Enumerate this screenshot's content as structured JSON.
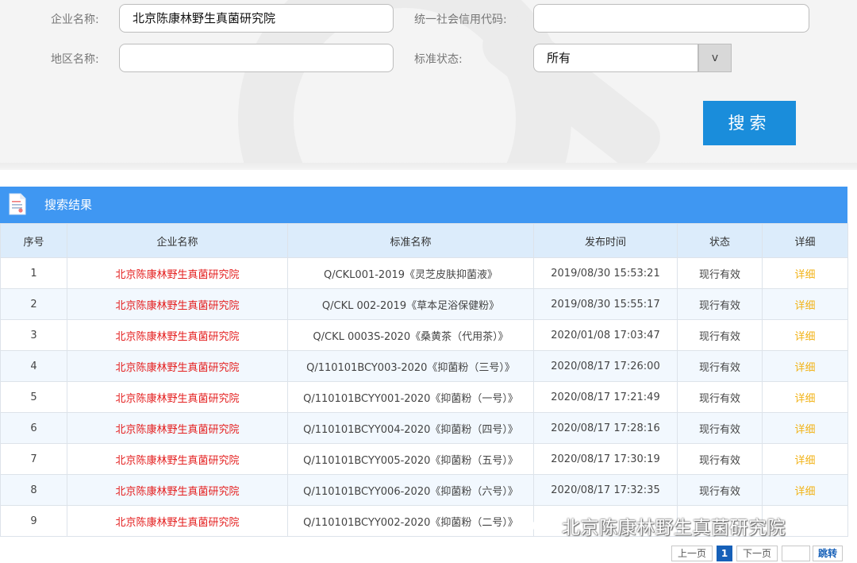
{
  "search": {
    "company_label": "企业名称:",
    "company_value": "北京陈康林野生真菌研究院",
    "credit_code_label": "统一社会信用代码:",
    "credit_code_value": "",
    "region_label": "地区名称:",
    "region_value": "",
    "status_label": "标准状态:",
    "status_value": "所有",
    "dropdown_glyph": "v",
    "search_button": "搜索"
  },
  "results": {
    "title": "搜索结果",
    "columns": [
      "序号",
      "企业名称",
      "标准名称",
      "发布时间",
      "状态",
      "详细"
    ],
    "rows": [
      {
        "no": "1",
        "company": "北京陈康林野生真菌研究院",
        "standard": "Q/CKL001-2019《灵芝皮肤抑菌液》",
        "date": "2019/08/30 15:53:21",
        "status": "现行有效",
        "detail": "详细"
      },
      {
        "no": "2",
        "company": "北京陈康林野生真菌研究院",
        "standard": "Q/CKL 002-2019《草本足浴保健粉》",
        "date": "2019/08/30 15:55:17",
        "status": "现行有效",
        "detail": "详细"
      },
      {
        "no": "3",
        "company": "北京陈康林野生真菌研究院",
        "standard": "Q/CKL 0003S-2020《桑黄茶（代用茶）》",
        "date": "2020/01/08 17:03:47",
        "status": "现行有效",
        "detail": "详细"
      },
      {
        "no": "4",
        "company": "北京陈康林野生真菌研究院",
        "standard": "Q/110101BCY003-2020《抑菌粉（三号）》",
        "date": "2020/08/17 17:26:00",
        "status": "现行有效",
        "detail": "详细"
      },
      {
        "no": "5",
        "company": "北京陈康林野生真菌研究院",
        "standard": "Q/110101BCYY001-2020《抑菌粉（一号）》",
        "date": "2020/08/17 17:21:49",
        "status": "现行有效",
        "detail": "详细"
      },
      {
        "no": "6",
        "company": "北京陈康林野生真菌研究院",
        "standard": "Q/110101BCYY004-2020《抑菌粉（四号）》",
        "date": "2020/08/17 17:28:16",
        "status": "现行有效",
        "detail": "详细"
      },
      {
        "no": "7",
        "company": "北京陈康林野生真菌研究院",
        "standard": "Q/110101BCYY005-2020《抑菌粉（五号）》",
        "date": "2020/08/17 17:30:19",
        "status": "现行有效",
        "detail": "详细"
      },
      {
        "no": "8",
        "company": "北京陈康林野生真菌研究院",
        "standard": "Q/110101BCYY006-2020《抑菌粉（六号）》",
        "date": "2020/08/17 17:32:35",
        "status": "现行有效",
        "detail": "详细"
      },
      {
        "no": "9",
        "company": "北京陈康林野生真菌研究院",
        "standard": "Q/110101BCYY002-2020《抑菌粉（二号）》",
        "date": "",
        "status": "",
        "detail": ""
      }
    ]
  },
  "watermark": "北京陈康林野生真菌研究院",
  "pagination": {
    "prev": "上一页",
    "current": "1",
    "next": "下一页",
    "page_input": "",
    "go": "跳转"
  },
  "colors": {
    "header_bar": "#3f97f2",
    "search_button": "#1a8ddb",
    "company_text": "#e41f1f",
    "detail_link": "#f2b318"
  }
}
